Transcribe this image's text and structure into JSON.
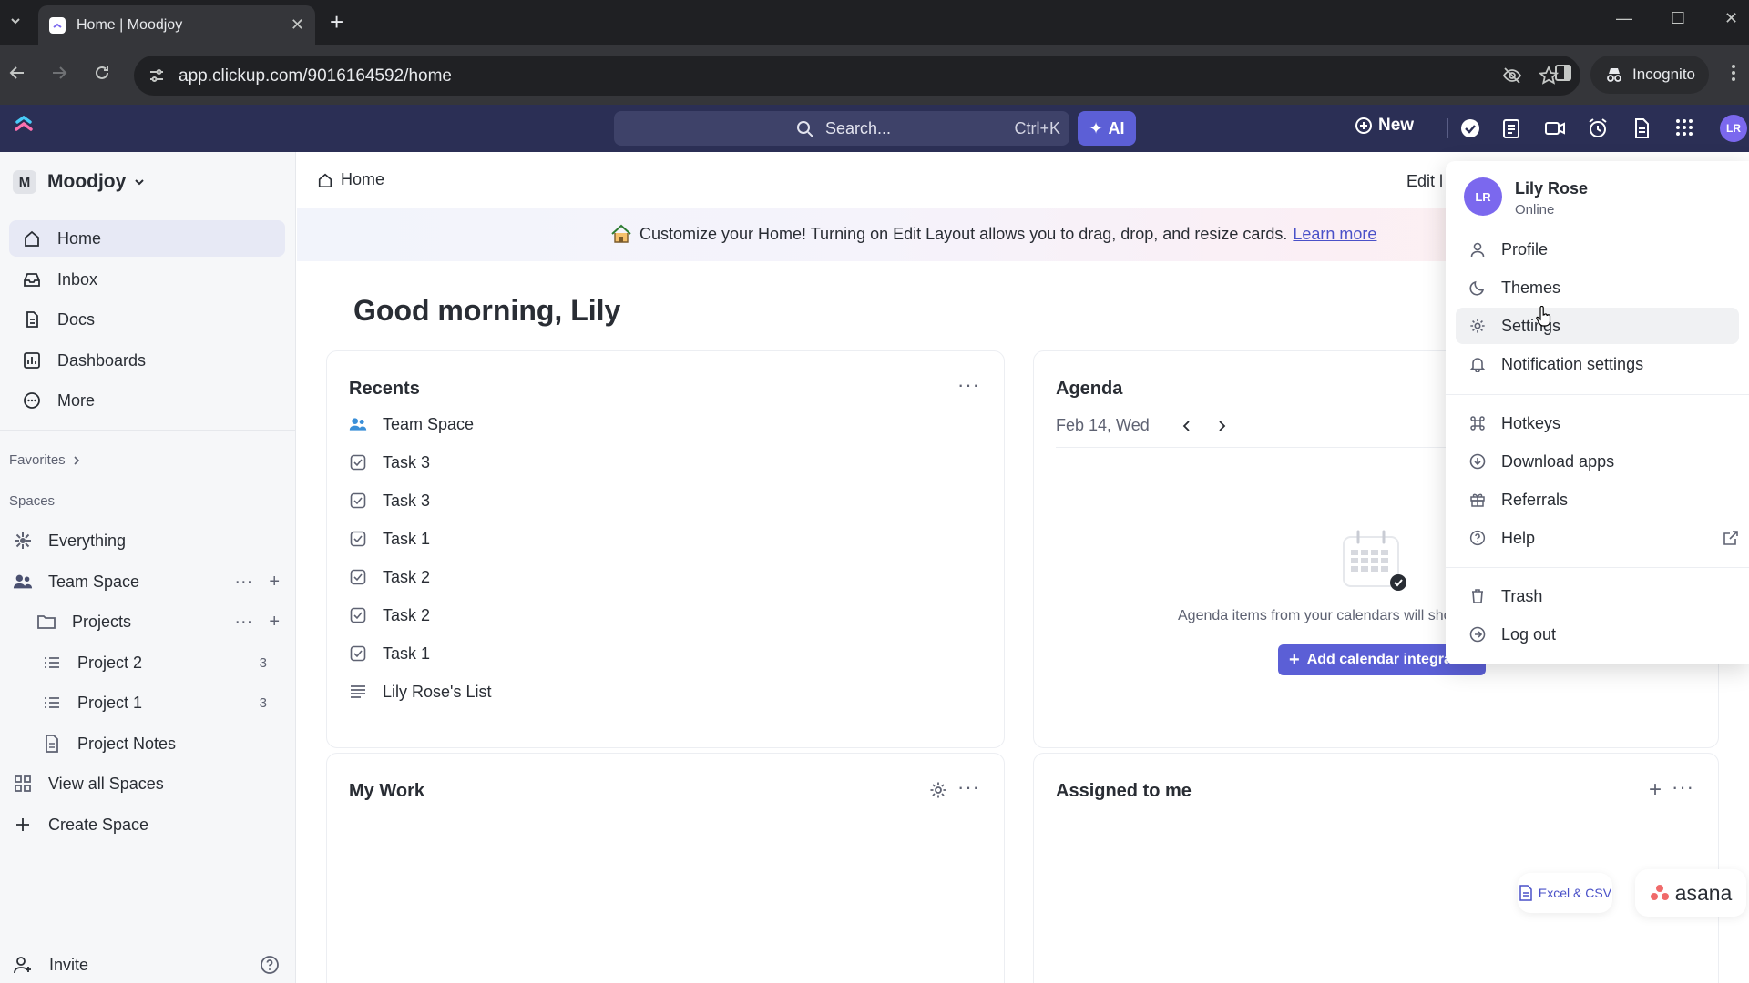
{
  "browser": {
    "tab_title": "Home | Moodjoy",
    "url": "app.clickup.com/9016164592/home",
    "incognito_label": "Incognito"
  },
  "header": {
    "search_placeholder": "Search...",
    "search_shortcut": "Ctrl+K",
    "ai_label": "AI",
    "new_label": "New",
    "avatar_initials": "LR"
  },
  "sidebar": {
    "workspace_initial": "M",
    "workspace_name": "Moodjoy",
    "nav": [
      {
        "label": "Home",
        "icon": "home-icon",
        "active": true
      },
      {
        "label": "Inbox",
        "icon": "inbox-icon"
      },
      {
        "label": "Docs",
        "icon": "docs-icon"
      },
      {
        "label": "Dashboards",
        "icon": "dashboards-icon"
      },
      {
        "label": "More",
        "icon": "more-icon"
      }
    ],
    "favorites_label": "Favorites",
    "spaces_label": "Spaces",
    "tree": {
      "everything": "Everything",
      "team_space": "Team Space",
      "projects": "Projects",
      "project2": "Project 2",
      "project2_count": "3",
      "project1": "Project 1",
      "project1_count": "3",
      "project_notes": "Project Notes",
      "view_all": "View all Spaces",
      "create_space": "Create Space"
    },
    "invite_label": "Invite"
  },
  "main": {
    "breadcrumb": "Home",
    "edit_label": "Edit l",
    "banner_text": "Customize your Home! Turning on Edit Layout allows you to drag, drop, and resize cards.",
    "banner_link": "Learn more",
    "greeting": "Good morning, Lily",
    "recents": {
      "title": "Recents",
      "items": [
        {
          "label": "Team Space",
          "icon": "team-space-icon"
        },
        {
          "label": "Task 3",
          "icon": "task-icon"
        },
        {
          "label": "Task 3",
          "icon": "task-icon"
        },
        {
          "label": "Task 1",
          "icon": "task-icon"
        },
        {
          "label": "Task 2",
          "icon": "task-icon"
        },
        {
          "label": "Task 2",
          "icon": "task-icon"
        },
        {
          "label": "Task 1",
          "icon": "task-icon"
        },
        {
          "label": "Lily Rose's List",
          "icon": "list-icon"
        }
      ]
    },
    "agenda": {
      "title": "Agenda",
      "date": "Feb 14, Wed",
      "empty_text": "Agenda items from your calendars will sho",
      "add_button": "Add calendar integrat"
    },
    "my_work": {
      "title": "My Work"
    },
    "assigned": {
      "title": "Assigned to me"
    },
    "excel_chip": "Excel & CSV",
    "asana_chip": "asana"
  },
  "user_menu": {
    "avatar_initials": "LR",
    "name": "Lily Rose",
    "status": "Online",
    "items": [
      {
        "label": "Profile",
        "icon": "profile-icon"
      },
      {
        "label": "Themes",
        "icon": "moon-icon"
      },
      {
        "label": "Settings",
        "icon": "gear-icon"
      },
      {
        "label": "Notification settings",
        "icon": "bell-icon"
      },
      {
        "label": "Hotkeys",
        "icon": "command-icon"
      },
      {
        "label": "Download apps",
        "icon": "download-icon"
      },
      {
        "label": "Referrals",
        "icon": "gift-icon"
      },
      {
        "label": "Help",
        "icon": "help-icon"
      },
      {
        "label": "Trash",
        "icon": "trash-icon"
      },
      {
        "label": "Log out",
        "icon": "logout-icon"
      }
    ]
  },
  "colors": {
    "app_header_bg": "#2b2f55",
    "accent": "#5b5fd6",
    "avatar": "#7b68ee"
  }
}
